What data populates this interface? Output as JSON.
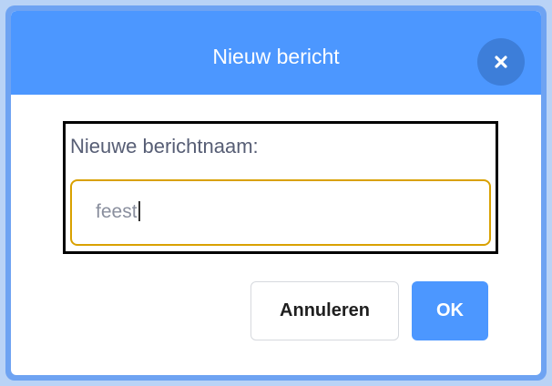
{
  "dialog": {
    "title": "Nieuw bericht",
    "close_icon": "close-icon",
    "prompt_label": "Nieuwe berichtnaam:",
    "input_value": "feest",
    "cancel_label": "Annuleren",
    "ok_label": "OK"
  },
  "colors": {
    "header": "#4c97ff",
    "ok_button": "#4c97ff",
    "input_border": "#d9a100",
    "label_text": "#575e75"
  }
}
